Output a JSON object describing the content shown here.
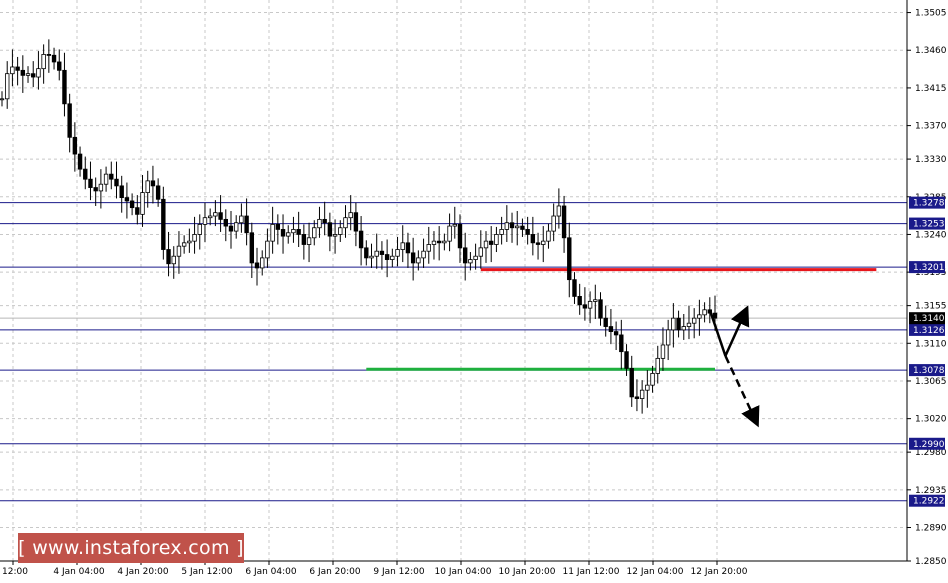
{
  "chart_data": {
    "type": "candlestick",
    "instrument_note": "",
    "x_labels": [
      "12:00",
      "4 Jan 04:00",
      "4 Jan 20:00",
      "5 Jan 12:00",
      "6 Jan 04:00",
      "6 Jan 20:00",
      "9 Jan 12:00",
      "10 Jan 04:00",
      "10 Jan 20:00",
      "11 Jan 12:00",
      "12 Jan 04:00",
      "12 Jan 20:00"
    ],
    "y_ticks": [
      "1.3505",
      "1.3460",
      "1.3415",
      "1.3370",
      "1.3330",
      "1.3285",
      "1.3240",
      "1.3195",
      "1.3155",
      "1.3110",
      "1.3065",
      "1.3020",
      "1.2980",
      "1.2935",
      "1.2890",
      "1.2850"
    ],
    "ylim": [
      1.285,
      1.352
    ],
    "grid": true,
    "current_price": "1.3140",
    "levels": [
      {
        "value": 1.3278,
        "label": "1.3278"
      },
      {
        "value": 1.3253,
        "label": "1.3253"
      },
      {
        "value": 1.3201,
        "label": "1.3201"
      },
      {
        "value": 1.3126,
        "label": "1.3126"
      },
      {
        "value": 1.3078,
        "label": "1.3078"
      },
      {
        "value": 1.299,
        "label": "1.2990"
      },
      {
        "value": 1.2922,
        "label": "1.2922"
      }
    ],
    "highlight_lines": [
      {
        "value": 1.3198,
        "color": "#e8161c",
        "from_x": 92,
        "to_x": 168
      },
      {
        "value": 1.3079,
        "color": "#1fb03e",
        "from_x": 70,
        "to_x": 137
      }
    ],
    "arrows": [
      {
        "from": [
          136,
          1.315
        ],
        "to": [
          139,
          1.3095
        ],
        "color": "#000000"
      },
      {
        "from": [
          139,
          1.3095
        ],
        "to": [
          143,
          1.315
        ],
        "color": "#000000"
      },
      {
        "from": [
          139,
          1.3095
        ],
        "to": [
          145,
          1.3015
        ],
        "color": "#000000"
      }
    ],
    "close_series": [
      1.3402,
      1.3432,
      1.344,
      1.3436,
      1.343,
      1.3432,
      1.3428,
      1.3438,
      1.3455,
      1.3454,
      1.3446,
      1.3436,
      1.3396,
      1.3356,
      1.3336,
      1.3318,
      1.3306,
      1.3296,
      1.3292,
      1.33,
      1.3312,
      1.3306,
      1.3298,
      1.3284,
      1.328,
      1.3272,
      1.3264,
      1.329,
      1.3304,
      1.3298,
      1.3282,
      1.3222,
      1.3205,
      1.3214,
      1.3226,
      1.323,
      1.3232,
      1.324,
      1.3252,
      1.326,
      1.3262,
      1.3266,
      1.3258,
      1.325,
      1.3244,
      1.3254,
      1.3262,
      1.3242,
      1.3206,
      1.32,
      1.3212,
      1.3232,
      1.3252,
      1.3246,
      1.3238,
      1.3242,
      1.3246,
      1.324,
      1.3228,
      1.3236,
      1.3248,
      1.3258,
      1.3254,
      1.3238,
      1.324,
      1.3248,
      1.326,
      1.3266,
      1.3244,
      1.3224,
      1.3212,
      1.3214,
      1.322,
      1.3216,
      1.321,
      1.3214,
      1.3222,
      1.323,
      1.3218,
      1.3206,
      1.3212,
      1.322,
      1.3228,
      1.3232,
      1.323,
      1.3232,
      1.325,
      1.3252,
      1.3224,
      1.3206,
      1.321,
      1.3214,
      1.3224,
      1.3232,
      1.3228,
      1.324,
      1.3246,
      1.3254,
      1.3248,
      1.325,
      1.3246,
      1.324,
      1.323,
      1.3228,
      1.3232,
      1.3244,
      1.3262,
      1.3274,
      1.3236,
      1.3186,
      1.3166,
      1.3156,
      1.3152,
      1.316,
      1.3162,
      1.314,
      1.313,
      1.3124,
      1.312,
      1.31,
      1.308,
      1.3046,
      1.3044,
      1.3054,
      1.306,
      1.3074,
      1.3092,
      1.3108,
      1.3126,
      1.314,
      1.3126,
      1.313,
      1.3134,
      1.314,
      1.3144,
      1.315,
      1.3146,
      1.314
    ]
  },
  "watermark": {
    "text": "[  www.instaforex.com  ]"
  }
}
